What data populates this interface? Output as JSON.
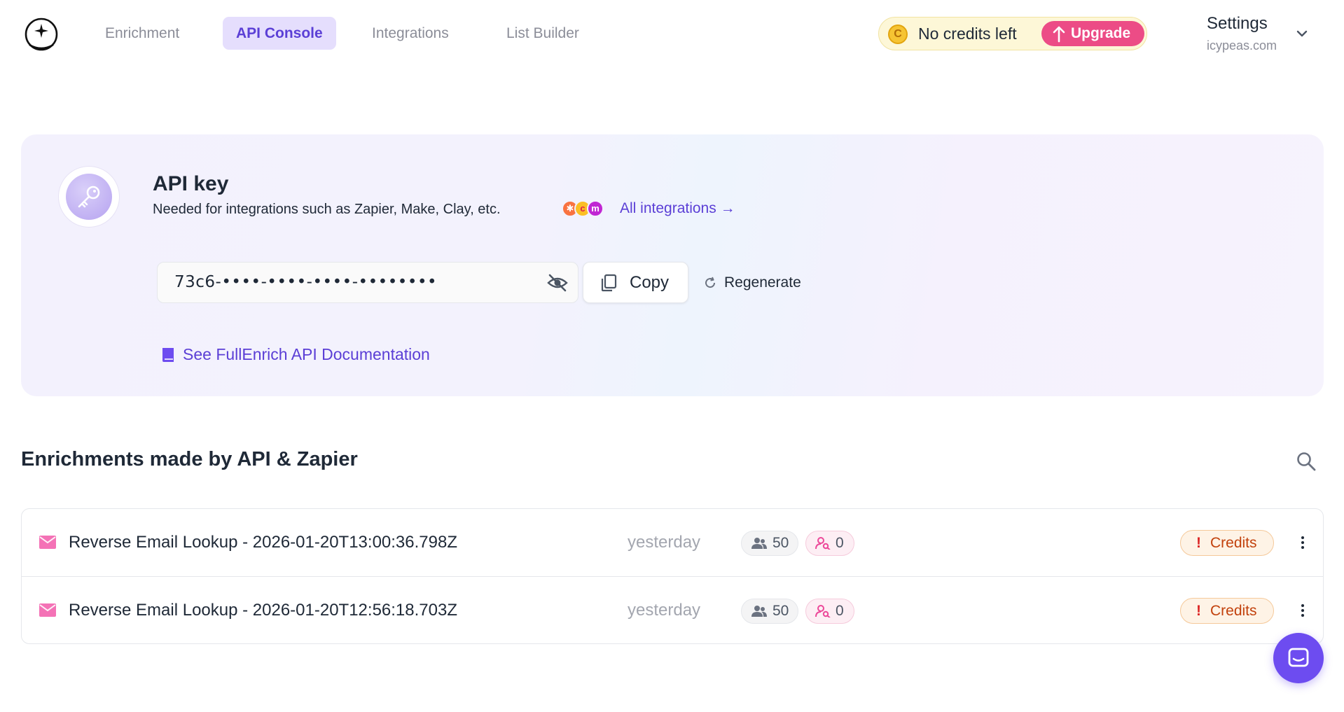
{
  "nav": {
    "items": [
      {
        "label": "Enrichment"
      },
      {
        "label": "API Console"
      },
      {
        "label": "Integrations"
      },
      {
        "label": "List Builder"
      }
    ],
    "active": "API Console"
  },
  "credits": {
    "coin_glyph": "C",
    "text": "No credits left",
    "upgrade_label": "Upgrade"
  },
  "settings": {
    "title": "Settings",
    "account": "icypeas.com"
  },
  "api_card": {
    "title": "API key",
    "subtitle": "Needed for integrations such as Zapier, Make, Clay, etc.",
    "integrations_link": "All integrations →",
    "integration_logos": [
      {
        "name": "hubspot-logo",
        "glyph": "✱",
        "color": "#f97340"
      },
      {
        "name": "clay-logo",
        "glyph": "c",
        "color": "#f43f5e"
      },
      {
        "name": "make-logo",
        "glyph": "m",
        "color": "#c026d3"
      }
    ],
    "key_masked": "73c6-••••-••••-••••-••••••••",
    "copy_label": "Copy",
    "regenerate_label": "Regenerate",
    "docs_link": "See FullEnrich API Documentation"
  },
  "enrichments": {
    "title": "Enrichments made by API & Zapier",
    "rows": [
      {
        "name": "Reverse Email Lookup - 2026-01-20T13:00:36.798Z",
        "date": "yesterday",
        "contacts": "50",
        "found": "0",
        "status": "Credits"
      },
      {
        "name": "Reverse Email Lookup - 2026-01-20T12:56:18.703Z",
        "date": "yesterday",
        "contacts": "50",
        "found": "0",
        "status": "Credits"
      }
    ]
  },
  "colors": {
    "accent": "#5b3fd6",
    "upgrade": "#ec4c86",
    "chat": "#6d4cf0"
  }
}
